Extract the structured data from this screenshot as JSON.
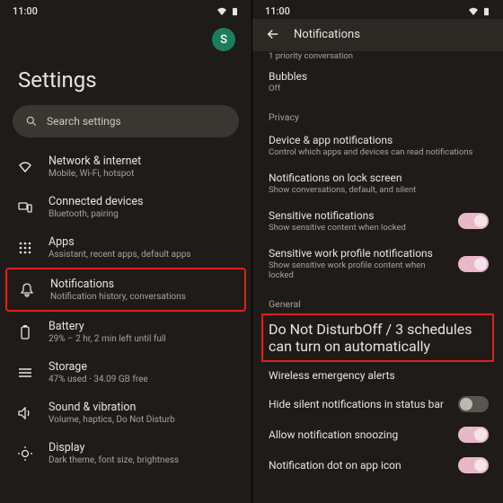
{
  "status": {
    "time": "11:00"
  },
  "left": {
    "avatar_initial": "S",
    "title": "Settings",
    "search_placeholder": "Search settings",
    "items": [
      {
        "label": "Network & internet",
        "sub": "Mobile, Wi-Fi, hotspot"
      },
      {
        "label": "Connected devices",
        "sub": "Bluetooth, pairing"
      },
      {
        "label": "Apps",
        "sub": "Assistant, recent apps, default apps"
      },
      {
        "label": "Notifications",
        "sub": "Notification history, conversations"
      },
      {
        "label": "Battery",
        "sub": "29% – 2 hr, 2 min left until full"
      },
      {
        "label": "Storage",
        "sub": "47% used · 34.09 GB free"
      },
      {
        "label": "Sound & vibration",
        "sub": "Volume, haptics, Do Not Disturb"
      },
      {
        "label": "Display",
        "sub": "Dark theme, font size, brightness"
      }
    ]
  },
  "right": {
    "header": "Notifications",
    "priority_line": "1 priority conversation",
    "bubbles": {
      "label": "Bubbles",
      "sub": "Off"
    },
    "sections": {
      "privacy": "Privacy",
      "general": "General"
    },
    "rows": {
      "device_app": {
        "label": "Device & app notifications",
        "sub": "Control which apps and devices can read notifications"
      },
      "lock": {
        "label": "Notifications on lock screen",
        "sub": "Show conversations, default, and silent"
      },
      "sensitive": {
        "label": "Sensitive notifications",
        "sub": "Show sensitive content when locked"
      },
      "sensitive_work": {
        "label": "Sensitive work profile notifications",
        "sub": "Show sensitive work profile content when locked"
      },
      "dnd": {
        "label": "Do Not Disturb",
        "sub": "Off / 3 schedules can turn on automatically"
      },
      "wea": {
        "label": "Wireless emergency alerts"
      },
      "hide_silent": {
        "label": "Hide silent notifications in status bar"
      },
      "snooze": {
        "label": "Allow notification snoozing"
      },
      "dot": {
        "label": "Notification dot on app icon"
      }
    },
    "toggles": {
      "sensitive": true,
      "sensitive_work": true,
      "hide_silent": false,
      "snooze": true,
      "dot": true
    }
  }
}
